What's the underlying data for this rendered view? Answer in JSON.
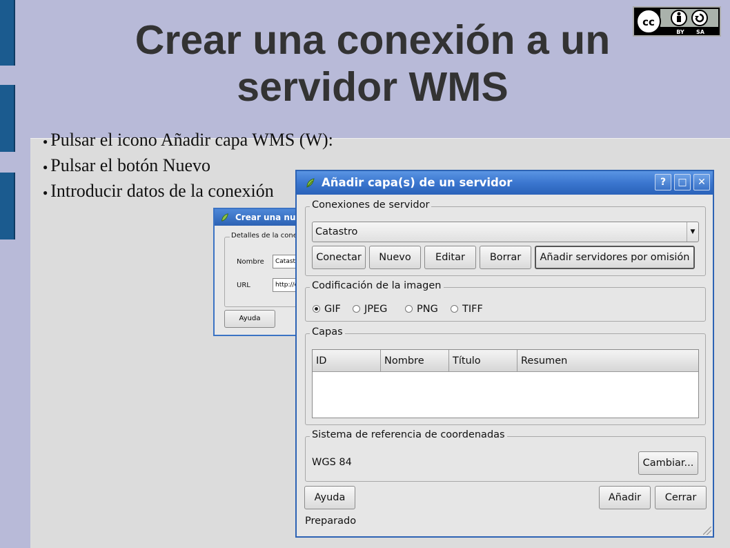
{
  "slide": {
    "title": "Crear una conexión a un servidor WMS",
    "bullets": [
      "Pulsar el icono Añadir capa WMS (W):",
      "Pulsar el botón Nuevo",
      "Introducir datos de la conexión"
    ]
  },
  "small_dialog": {
    "title": "Crear una nueva conexión",
    "group_label": "Detalles de la conexión",
    "name_label": "Nombre",
    "name_value": "Catastro",
    "url_label": "URL",
    "url_value": "http://ovc.catastro",
    "help_button": "Ayuda"
  },
  "dialog": {
    "title": "Añadir capa(s) de un servidor",
    "titlebar_buttons": {
      "help": "?",
      "maximize": "□",
      "close": "✕"
    },
    "connections": {
      "legend": "Conexiones de servidor",
      "selected": "Catastro",
      "buttons": {
        "connect": "Conectar",
        "new": "Nuevo",
        "edit": "Editar",
        "delete": "Borrar",
        "add_defaults": "Añadir servidores por omisión"
      }
    },
    "encoding": {
      "legend": "Codificación de la imagen",
      "options": [
        "GIF",
        "JPEG",
        "PNG",
        "TIFF"
      ],
      "selected": "GIF"
    },
    "layers": {
      "legend": "Capas",
      "columns": [
        "ID",
        "Nombre",
        "Título",
        "Resumen"
      ]
    },
    "crs": {
      "legend": "Sistema de referencia de coordenadas",
      "value": "WGS 84",
      "change_button": "Cambiar..."
    },
    "buttons": {
      "help": "Ayuda",
      "add": "Añadir",
      "close": "Cerrar"
    },
    "status": "Preparado"
  },
  "colors": {
    "slide_background": "#b8bad8",
    "accent_bar": "#1b5b8f",
    "titlebar": "#3b76cf"
  },
  "icons": [
    "cc-by-sa-icon",
    "qgis-icon"
  ]
}
